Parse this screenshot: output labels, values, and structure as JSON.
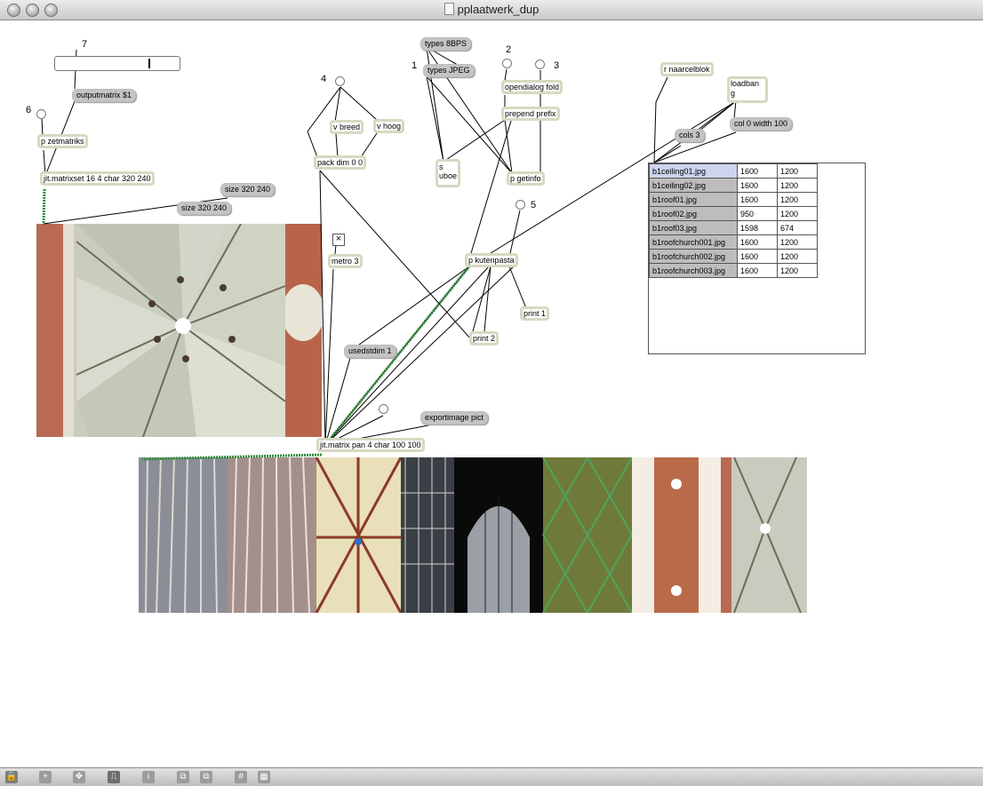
{
  "window": {
    "title": "pplaatwerk_dup"
  },
  "number_labels": [
    "7",
    "6",
    "4",
    "1",
    "2",
    "3",
    "5"
  ],
  "objects": {
    "outputmatrix": "outputmatrix $1",
    "p_zetmatriks": "p zetmatriks",
    "jit_matrixset": "jit.matrixset 16 4 char 320 240",
    "size_a": "size 320 240",
    "size_b": "size 320 240",
    "v_breed": "v breed",
    "v_hoog": "v hoog",
    "pack_dim": "pack dim 0 0",
    "metro": "metro 3",
    "usedstdim": "usedstdim 1",
    "types_8bps": "types 8BPS",
    "types_jpeg": "types JPEG",
    "opendialog": "opendialog fold",
    "prepend_prefix": "prepend prefix",
    "s_uboe_1": "s",
    "s_uboe_2": "uboe",
    "p_getinfo": "p getinfo",
    "p_kutenpasta": "p kutenpasta",
    "print_1": "print 1",
    "print_2": "print 2",
    "exportimage": "exportimage pict",
    "jit_matrix_pan": "jit.matrix pan 4 char 100 100",
    "r_naarcelblok": "r naarcelblok",
    "loadbang_1": "loadban",
    "loadbang_2": "g",
    "cols": "cols 3",
    "col_width": "col 0 width 100",
    "toggle_mark": "×"
  },
  "table": {
    "rows": [
      [
        "b1ceiling01.jpg",
        "1600",
        "1200"
      ],
      [
        "b1ceiling02.jpg",
        "1600",
        "1200"
      ],
      [
        "b1roof01.jpg",
        "1600",
        "1200"
      ],
      [
        "b1roof02.jpg",
        "950",
        "1200"
      ],
      [
        "b1roof03.jpg",
        "1598",
        "674"
      ],
      [
        "b1roofchurch001.jpg",
        "1600",
        "1200"
      ],
      [
        "b1roofchurch002.jpg",
        "1600",
        "1200"
      ],
      [
        "b1roofchurch003.jpg",
        "1600",
        "1200"
      ]
    ]
  },
  "slider": {
    "value": 0.76
  },
  "colors": {
    "object_border": "#d8d8c2",
    "message_box": "#c4c4c4",
    "patch_cord_matrix": "#2e8b3a",
    "table_selected": "#cdd4ee"
  },
  "bottom_toolbar": [
    "lock-icon",
    "new-object-icon",
    "move-icon",
    "presentation-icon",
    "info-icon",
    "copy-icon",
    "paste-icon",
    "grid-icon",
    "snap-icon"
  ]
}
